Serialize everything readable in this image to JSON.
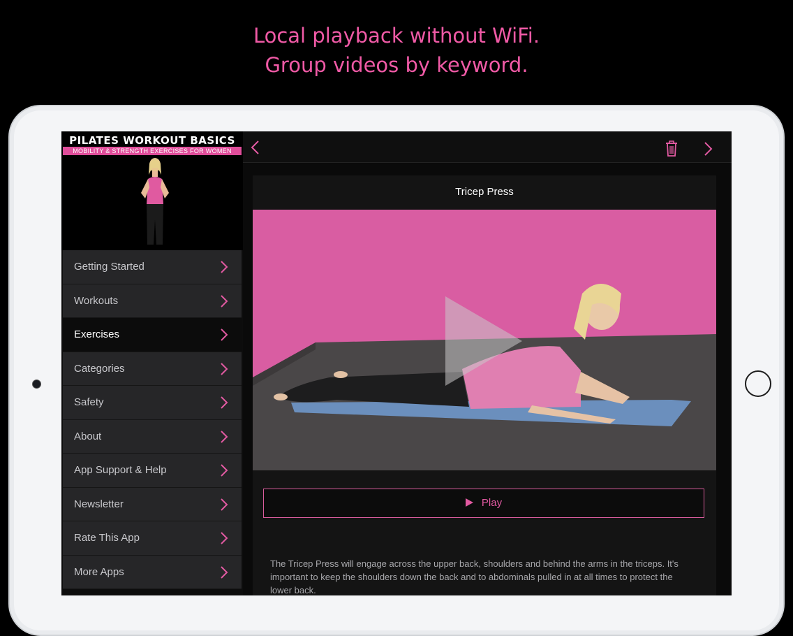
{
  "promo": {
    "line1": "Local playback without WiFi.",
    "line2": "Group videos by keyword."
  },
  "brand": {
    "title": "PILATES WORKOUT BASICS",
    "subtitle": "MOBILITY & STRENGTH EXERCISES FOR WOMEN"
  },
  "menu": {
    "items": [
      {
        "label": "Getting Started"
      },
      {
        "label": "Workouts"
      },
      {
        "label": "Exercises",
        "active": true
      },
      {
        "label": "Categories"
      },
      {
        "label": "Safety"
      },
      {
        "label": "About"
      },
      {
        "label": "App Support & Help"
      },
      {
        "label": "Newsletter"
      },
      {
        "label": "Rate This App"
      },
      {
        "label": "More Apps"
      }
    ]
  },
  "toolbar": {
    "back_icon": "chevron-left-icon",
    "delete_icon": "trash-icon",
    "next_icon": "chevron-right-icon"
  },
  "video": {
    "title": "Tricep Press",
    "play_label": "Play",
    "description": "The Tricep Press will engage across the upper back, shoulders and behind the arms in the triceps. It's important to keep the shoulders down the back and to abdominals pulled in at all times to protect the lower back."
  },
  "colors": {
    "accent": "#e25aa2",
    "background": "#000000",
    "menu_bg": "#262628",
    "video_bg": "#d95da2"
  }
}
